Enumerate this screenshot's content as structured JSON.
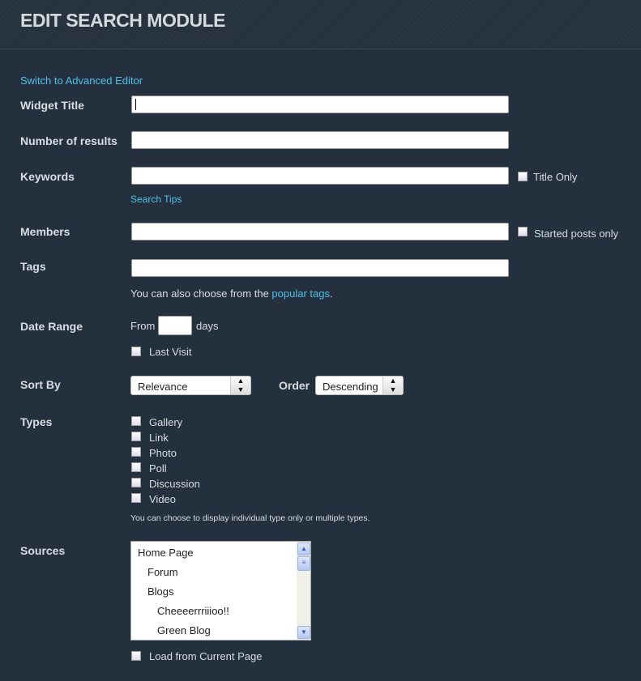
{
  "header": {
    "title": "EDIT SEARCH MODULE"
  },
  "switch_link": "Switch to Advanced Editor",
  "fields": {
    "widget_title": {
      "label": "Widget Title",
      "value": ""
    },
    "num_results": {
      "label": "Number of results",
      "value": ""
    },
    "keywords": {
      "label": "Keywords",
      "value": "",
      "title_only": "Title Only",
      "search_tips": "Search Tips"
    },
    "members": {
      "label": "Members",
      "value": "",
      "started_only": "Started posts only"
    },
    "tags": {
      "label": "Tags",
      "value": "",
      "help_prefix": "You can also choose from the ",
      "help_link": "popular tags",
      "help_suffix": "."
    },
    "date_range": {
      "label": "Date Range",
      "from": "From",
      "days": "days",
      "value": "",
      "last_visit": "Last Visit"
    },
    "sort_by": {
      "label": "Sort By",
      "value": "Relevance",
      "order_label": "Order",
      "order_value": "Descending"
    },
    "types": {
      "label": "Types",
      "items": [
        "Gallery",
        "Link",
        "Photo",
        "Poll",
        "Discussion",
        "Video"
      ],
      "help": "You can choose to display individual type only or multiple types."
    },
    "sources": {
      "label": "Sources",
      "items": [
        "Home Page",
        "Forum",
        "Blogs",
        "Cheeeerrriiioo!!",
        "Green Blog"
      ],
      "load_current": "Load from Current Page"
    }
  }
}
